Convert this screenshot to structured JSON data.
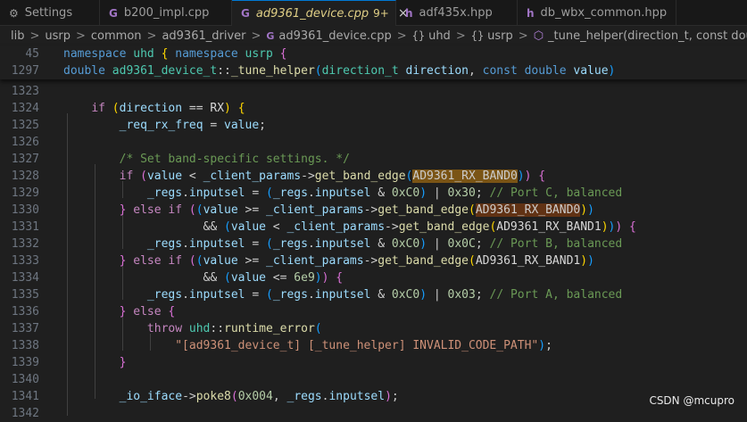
{
  "tabs": [
    {
      "icon": "gear-icon",
      "glyph": "⚙",
      "label": "Settings"
    },
    {
      "icon": "cpp-file-icon",
      "glyph": "G",
      "label": "b200_impl.cpp"
    },
    {
      "icon": "cpp-file-icon",
      "glyph": "G",
      "label": "ad9361_device.cpp",
      "modified": "9+",
      "close": "×"
    },
    {
      "icon": "hpp-file-icon",
      "glyph": "h",
      "label": "adf435x.hpp"
    },
    {
      "icon": "hpp-file-icon",
      "glyph": "h",
      "label": "db_wbx_common.hpp"
    }
  ],
  "breadcrumb": {
    "items": [
      "lib",
      "usrp",
      "common",
      "ad9361_driver"
    ],
    "file": "ad9361_device.cpp",
    "file_glyph": "G",
    "ns1": "uhd",
    "ns2": "usrp",
    "ns_glyph": "{}",
    "fn_glyph": "⬡",
    "function": "_tune_helper(direction_t, const double)",
    "separator": ">"
  },
  "editor": {
    "sticky_lines": [
      {
        "num": "45",
        "segs": [
          [
            "kw",
            "namespace"
          ],
          [
            "op",
            " "
          ],
          [
            "ty",
            "uhd"
          ],
          [
            "op",
            " "
          ],
          [
            "br1",
            "{"
          ],
          [
            "op",
            " "
          ],
          [
            "kw",
            "namespace"
          ],
          [
            "op",
            " "
          ],
          [
            "ty",
            "usrp"
          ],
          [
            "op",
            " "
          ],
          [
            "br2",
            "{"
          ]
        ]
      },
      {
        "num": "1297",
        "segs": [
          [
            "kw",
            "double"
          ],
          [
            "op",
            " "
          ],
          [
            "ty",
            "ad9361_device_t"
          ],
          [
            "op",
            "::"
          ],
          [
            "fn",
            "_tune_helper"
          ],
          [
            "br3",
            "("
          ],
          [
            "ty",
            "direction_t"
          ],
          [
            "op",
            " "
          ],
          [
            "var",
            "direction"
          ],
          [
            "op",
            ", "
          ],
          [
            "kw",
            "const"
          ],
          [
            "op",
            " "
          ],
          [
            "kw",
            "double"
          ],
          [
            "op",
            " "
          ],
          [
            "var",
            "value"
          ],
          [
            "br3",
            ")"
          ]
        ]
      }
    ],
    "lines": [
      {
        "num": "1323",
        "segs": []
      },
      {
        "num": "1324",
        "segs": [
          [
            "op",
            "    "
          ],
          [
            "ctl",
            "if"
          ],
          [
            "op",
            " "
          ],
          [
            "br1",
            "("
          ],
          [
            "var",
            "direction"
          ],
          [
            "op",
            " == "
          ],
          [
            "mac",
            "RX"
          ],
          [
            "br1",
            ")"
          ],
          [
            "op",
            " "
          ],
          [
            "br1",
            "{"
          ]
        ]
      },
      {
        "num": "1325",
        "segs": [
          [
            "op",
            "        "
          ],
          [
            "var",
            "_req_rx_freq"
          ],
          [
            "op",
            " = "
          ],
          [
            "var",
            "value"
          ],
          [
            "op",
            ";"
          ]
        ]
      },
      {
        "num": "1326",
        "segs": []
      },
      {
        "num": "1327",
        "segs": [
          [
            "op",
            "        "
          ],
          [
            "cmt",
            "/* Set band-specific settings. */"
          ]
        ]
      },
      {
        "num": "1328",
        "segs": [
          [
            "op",
            "        "
          ],
          [
            "ctl",
            "if"
          ],
          [
            "op",
            " "
          ],
          [
            "br2",
            "("
          ],
          [
            "var",
            "value"
          ],
          [
            "op",
            " < "
          ],
          [
            "var",
            "_client_params"
          ],
          [
            "op",
            "->"
          ],
          [
            "fn",
            "get_band_edge"
          ],
          [
            "br3",
            "("
          ],
          [
            "hl",
            "AD9361_RX_BAND0"
          ],
          [
            "br3",
            ")"
          ],
          [
            "br2",
            ")"
          ],
          [
            "op",
            " "
          ],
          [
            "br2",
            "{"
          ]
        ]
      },
      {
        "num": "1329",
        "segs": [
          [
            "op",
            "            "
          ],
          [
            "var",
            "_regs"
          ],
          [
            "op",
            "."
          ],
          [
            "var",
            "inputsel"
          ],
          [
            "op",
            " = "
          ],
          [
            "br3",
            "("
          ],
          [
            "var",
            "_regs"
          ],
          [
            "op",
            "."
          ],
          [
            "var",
            "inputsel"
          ],
          [
            "op",
            " & "
          ],
          [
            "num",
            "0xC0"
          ],
          [
            "br3",
            ")"
          ],
          [
            "op",
            " | "
          ],
          [
            "num",
            "0x30"
          ],
          [
            "op",
            "; "
          ],
          [
            "cmt",
            "// Port C, balanced"
          ]
        ]
      },
      {
        "num": "1330",
        "segs": [
          [
            "op",
            "        "
          ],
          [
            "br2",
            "}"
          ],
          [
            "op",
            " "
          ],
          [
            "ctl",
            "else"
          ],
          [
            "op",
            " "
          ],
          [
            "ctl",
            "if"
          ],
          [
            "op",
            " "
          ],
          [
            "br2",
            "("
          ],
          [
            "br3",
            "("
          ],
          [
            "var",
            "value"
          ],
          [
            "op",
            " >= "
          ],
          [
            "var",
            "_client_params"
          ],
          [
            "op",
            "->"
          ],
          [
            "fn",
            "get_band_edge"
          ],
          [
            "br1",
            "("
          ],
          [
            "hl2",
            "AD9361_RX_BAND0"
          ],
          [
            "br1",
            ")"
          ],
          [
            "br3",
            ")"
          ]
        ]
      },
      {
        "num": "1331",
        "segs": [
          [
            "op",
            "                    && "
          ],
          [
            "br3",
            "("
          ],
          [
            "var",
            "value"
          ],
          [
            "op",
            " < "
          ],
          [
            "var",
            "_client_params"
          ],
          [
            "op",
            "->"
          ],
          [
            "fn",
            "get_band_edge"
          ],
          [
            "br1",
            "("
          ],
          [
            "mac",
            "AD9361_RX_BAND1"
          ],
          [
            "br1",
            ")"
          ],
          [
            "br3",
            ")"
          ],
          [
            "br2",
            ")"
          ],
          [
            "op",
            " "
          ],
          [
            "br2",
            "{"
          ]
        ]
      },
      {
        "num": "1332",
        "segs": [
          [
            "op",
            "            "
          ],
          [
            "var",
            "_regs"
          ],
          [
            "op",
            "."
          ],
          [
            "var",
            "inputsel"
          ],
          [
            "op",
            " = "
          ],
          [
            "br3",
            "("
          ],
          [
            "var",
            "_regs"
          ],
          [
            "op",
            "."
          ],
          [
            "var",
            "inputsel"
          ],
          [
            "op",
            " & "
          ],
          [
            "num",
            "0xC0"
          ],
          [
            "br3",
            ")"
          ],
          [
            "op",
            " | "
          ],
          [
            "num",
            "0x0C"
          ],
          [
            "op",
            "; "
          ],
          [
            "cmt",
            "// Port B, balanced"
          ]
        ]
      },
      {
        "num": "1333",
        "segs": [
          [
            "op",
            "        "
          ],
          [
            "br2",
            "}"
          ],
          [
            "op",
            " "
          ],
          [
            "ctl",
            "else"
          ],
          [
            "op",
            " "
          ],
          [
            "ctl",
            "if"
          ],
          [
            "op",
            " "
          ],
          [
            "br2",
            "("
          ],
          [
            "br3",
            "("
          ],
          [
            "var",
            "value"
          ],
          [
            "op",
            " >= "
          ],
          [
            "var",
            "_client_params"
          ],
          [
            "op",
            "->"
          ],
          [
            "fn",
            "get_band_edge"
          ],
          [
            "br1",
            "("
          ],
          [
            "mac",
            "AD9361_RX_BAND1"
          ],
          [
            "br1",
            ")"
          ],
          [
            "br3",
            ")"
          ]
        ]
      },
      {
        "num": "1334",
        "segs": [
          [
            "op",
            "                    && "
          ],
          [
            "br3",
            "("
          ],
          [
            "var",
            "value"
          ],
          [
            "op",
            " <= "
          ],
          [
            "num",
            "6e9"
          ],
          [
            "br3",
            ")"
          ],
          [
            "br2",
            ")"
          ],
          [
            "op",
            " "
          ],
          [
            "br2",
            "{"
          ]
        ]
      },
      {
        "num": "1335",
        "segs": [
          [
            "op",
            "            "
          ],
          [
            "var",
            "_regs"
          ],
          [
            "op",
            "."
          ],
          [
            "var",
            "inputsel"
          ],
          [
            "op",
            " = "
          ],
          [
            "br3",
            "("
          ],
          [
            "var",
            "_regs"
          ],
          [
            "op",
            "."
          ],
          [
            "var",
            "inputsel"
          ],
          [
            "op",
            " & "
          ],
          [
            "num",
            "0xC0"
          ],
          [
            "br3",
            ")"
          ],
          [
            "op",
            " | "
          ],
          [
            "num",
            "0x03"
          ],
          [
            "op",
            "; "
          ],
          [
            "cmt",
            "// Port A, balanced"
          ]
        ]
      },
      {
        "num": "1336",
        "segs": [
          [
            "op",
            "        "
          ],
          [
            "br2",
            "}"
          ],
          [
            "op",
            " "
          ],
          [
            "ctl",
            "else"
          ],
          [
            "op",
            " "
          ],
          [
            "br2",
            "{"
          ]
        ]
      },
      {
        "num": "1337",
        "segs": [
          [
            "op",
            "            "
          ],
          [
            "ctl",
            "throw"
          ],
          [
            "op",
            " "
          ],
          [
            "ty",
            "uhd"
          ],
          [
            "op",
            "::"
          ],
          [
            "fn",
            "runtime_error"
          ],
          [
            "br3",
            "("
          ]
        ]
      },
      {
        "num": "1338",
        "segs": [
          [
            "op",
            "                "
          ],
          [
            "str",
            "\"[ad9361_device_t] [_tune_helper] INVALID_CODE_PATH\""
          ],
          [
            "br3",
            ")"
          ],
          [
            "op",
            ";"
          ]
        ]
      },
      {
        "num": "1339",
        "segs": [
          [
            "op",
            "        "
          ],
          [
            "br2",
            "}"
          ]
        ]
      },
      {
        "num": "1340",
        "segs": []
      },
      {
        "num": "1341",
        "segs": [
          [
            "op",
            "        "
          ],
          [
            "var",
            "_io_iface"
          ],
          [
            "op",
            "->"
          ],
          [
            "fn",
            "poke8"
          ],
          [
            "br2",
            "("
          ],
          [
            "num",
            "0x004"
          ],
          [
            "op",
            ", "
          ],
          [
            "var",
            "_regs"
          ],
          [
            "op",
            "."
          ],
          [
            "var",
            "inputsel"
          ],
          [
            "br2",
            ")"
          ],
          [
            "op",
            ";"
          ]
        ]
      },
      {
        "num": "1342",
        "segs": []
      }
    ]
  },
  "watermark": "CSDN @mcupro"
}
